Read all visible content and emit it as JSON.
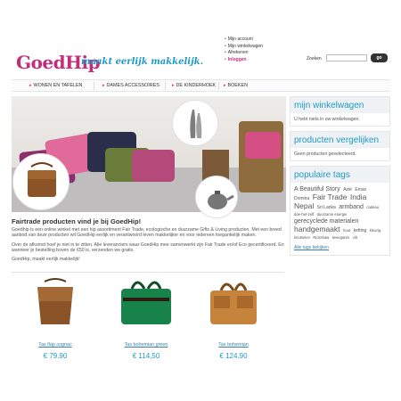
{
  "header": {
    "logo": "GoedHip",
    "tagline": "maakt eerlijk makkelijk.",
    "toplinks": [
      "Mijn account",
      "Mijn winkelwagen",
      "Afrekenen",
      "Inloggen"
    ],
    "search_label": "Zoeken",
    "search_value": "",
    "search_button": "go"
  },
  "nav": {
    "items": [
      "WONEN EN TAFELEN",
      "DAMES ACCESSOIRES",
      "DE KINDERHOEK",
      "BOEKEN"
    ]
  },
  "intro": {
    "title": "Fairtrade producten vind je bij GoedHip!",
    "paragraphs": [
      "Goedhip is een online winkel met een hip assortiment Fair Trade, ecologische en duurzame Gifts & Living producten. Met een breed aanbod van deze producten wil GoedHip eerlijk en verantwoord leven makkelijker en voor iedereen toegankelijk maken.",
      "Over de afkomst hoef je niet in te zitten. Alle leveranciers waar GoedHip mee samenwerkt zijn Fair Trade en/of Eco gecertificeerd. En wanneer je bestelling boven de €50 is, verzenden we gratis.",
      "GoedHip, maakt eerlijk makkelijk!"
    ]
  },
  "products": [
    {
      "name": "Tas flap cognac",
      "price": "€ 79.90"
    },
    {
      "name": "Tas bohemian green",
      "price": "€ 114,50"
    },
    {
      "name": "Tas bohemian",
      "price": "€ 124.90"
    }
  ],
  "sidebar": {
    "cart": {
      "title": "mijn winkelwagen",
      "text": "U hebt niets in uw winkelwagen."
    },
    "compare": {
      "title": "producten vergelijken",
      "text": "Geen producten geselecteerd."
    },
    "tags": {
      "title": "populaire tags",
      "items": [
        {
          "label": "A Beautiful Story",
          "size": 2
        },
        {
          "label": "Azië",
          "size": 1
        },
        {
          "label": "Emax",
          "size": 1
        },
        {
          "label": "Domina",
          "size": 1
        },
        {
          "label": "Fair Trade",
          "size": 3
        },
        {
          "label": "India",
          "size": 3
        },
        {
          "label": "Nepal",
          "size": 3
        },
        {
          "label": "Sri Lanka",
          "size": 1
        },
        {
          "label": "armband",
          "size": 2
        },
        {
          "label": "cadeau",
          "size": 4
        },
        {
          "label": "doe-het-zelf",
          "size": 4
        },
        {
          "label": "duurzame energie",
          "size": 4
        },
        {
          "label": "gerecyclede materialen",
          "size": 2
        },
        {
          "label": "handgemaakt",
          "size": 3
        },
        {
          "label": "hout",
          "size": 4
        },
        {
          "label": "ketting",
          "size": 1
        },
        {
          "label": "kleurig",
          "size": 4
        },
        {
          "label": "knutselen",
          "size": 4
        },
        {
          "label": "Rickshaw",
          "size": 4
        },
        {
          "label": "tweegaren",
          "size": 4
        },
        {
          "label": "vilt",
          "size": 4
        }
      ],
      "more": "Alle tags bekijken"
    }
  },
  "colors": {
    "brand_pink": "#c42d7c",
    "accent_blue": "#1f9ac7"
  }
}
